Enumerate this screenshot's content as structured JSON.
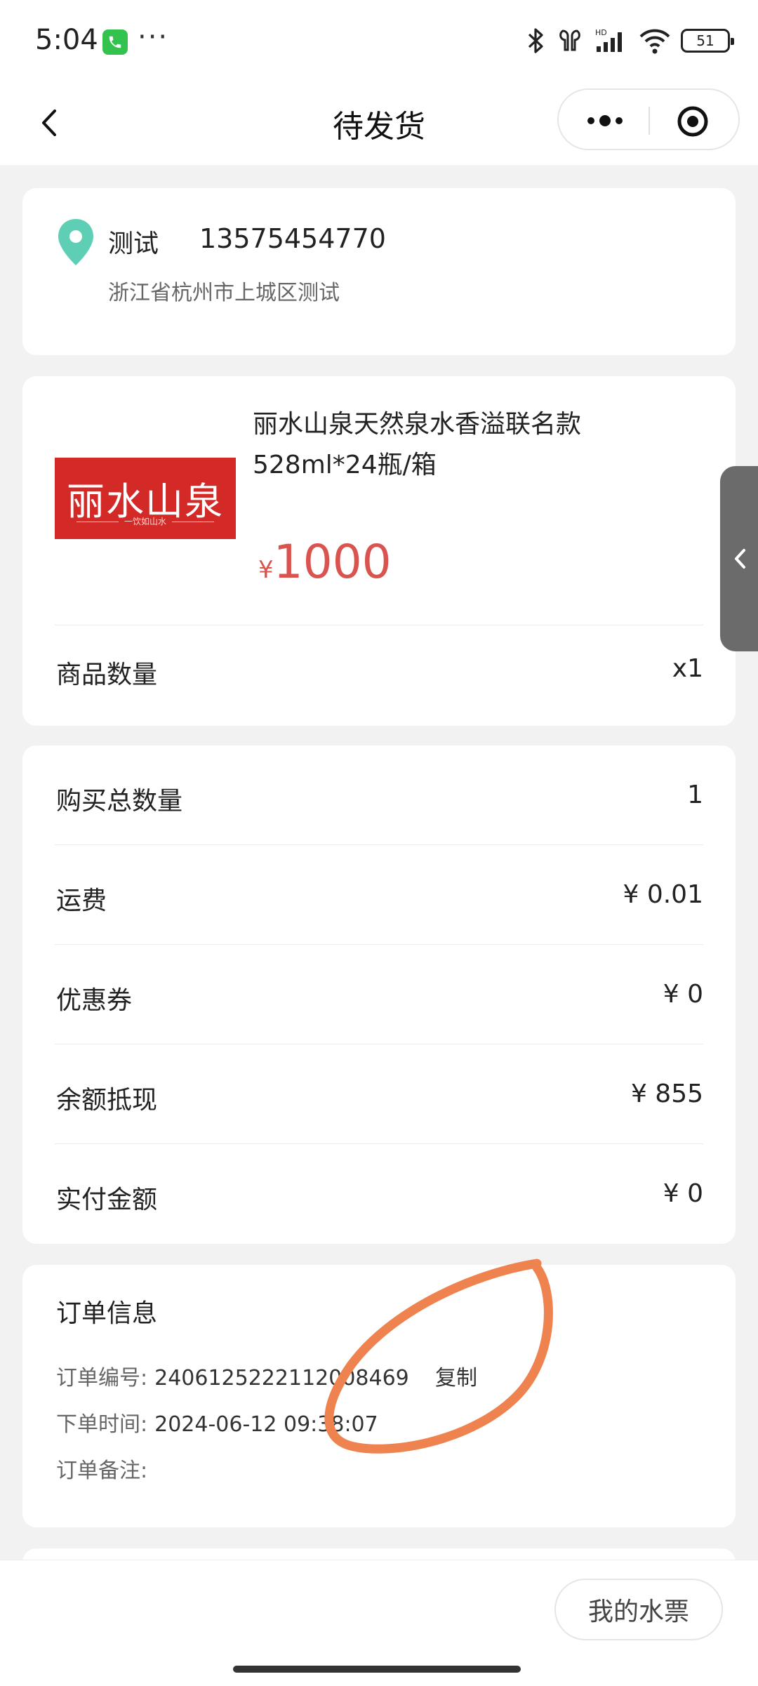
{
  "status_bar": {
    "time": "5:04",
    "overflow": "···",
    "battery": "51",
    "icons": [
      "phone-call-icon",
      "bluetooth-icon",
      "earbuds-icon",
      "hd-signal-icon",
      "wifi-icon",
      "battery-icon"
    ]
  },
  "nav": {
    "title": "待发货",
    "icons": [
      "back-icon",
      "more-icon",
      "target-icon"
    ]
  },
  "address": {
    "name": "测试",
    "phone": "13575454770",
    "line": "浙江省杭州市上城区测试",
    "icon": "location-pin-icon",
    "pin_color": "#5ecfb5"
  },
  "product": {
    "image_brand": "丽水山泉",
    "image_slogan": "一饮如山水",
    "name": "丽水山泉天然泉水香溢联名款528ml*24瓶/箱",
    "currency": "¥",
    "price": "1000",
    "quantity_label": "商品数量",
    "quantity_value": "x1",
    "price_color": "#d9534f"
  },
  "summary": {
    "rows": [
      {
        "label": "购买总数量",
        "value": "1"
      },
      {
        "label": "运费",
        "value": "¥ 0.01"
      },
      {
        "label": "优惠券",
        "value": "¥ 0"
      },
      {
        "label": "余额抵现",
        "value": "¥ 855"
      },
      {
        "label": "实付金额",
        "value": "¥ 0"
      }
    ]
  },
  "order_info": {
    "title": "订单信息",
    "number_label": "订单编号:",
    "number_value": "2406125222112008469",
    "copy_label": "复制",
    "time_label": "下单时间:",
    "time_value": "2024-06-12 09:38:07",
    "remark_label": "订单备注:"
  },
  "bottom": {
    "water_ticket_label": "我的水票"
  },
  "annotation_color": "#ee8350"
}
